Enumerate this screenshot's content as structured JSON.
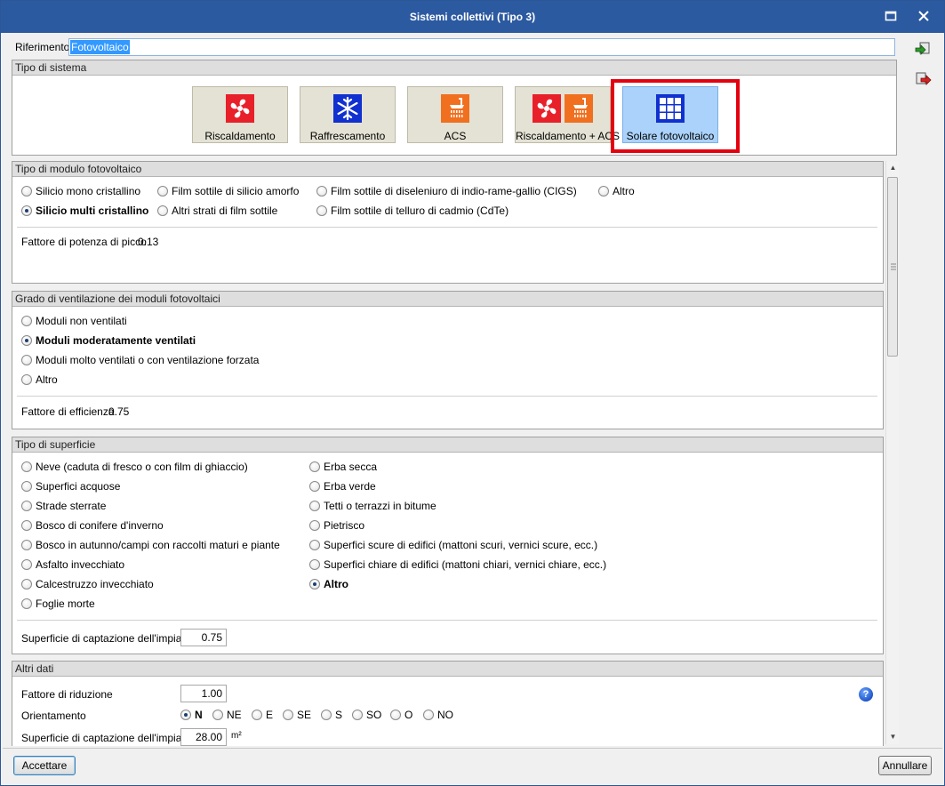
{
  "window": {
    "title": "Sistemi collettivi (Tipo 3)"
  },
  "riferimento": {
    "label": "Riferimento",
    "value": "Fotovoltaico"
  },
  "tipo_sistema": {
    "header": "Tipo di sistema",
    "buttons": [
      {
        "label": "Riscaldamento",
        "icon": "fan-icon"
      },
      {
        "label": "Raffrescamento",
        "icon": "snowflake-icon"
      },
      {
        "label": "ACS",
        "icon": "shower-icon"
      },
      {
        "label": "Riscaldamento + ACS",
        "icon": "fan-shower-icon"
      },
      {
        "label": "Solare fotovoltaico",
        "icon": "solar-panel-icon",
        "selected": true
      }
    ]
  },
  "modulo": {
    "header": "Tipo di modulo fotovoltaico",
    "options": [
      "Silicio mono cristallino",
      "Film sottile di silicio amorfo",
      "Film sottile di diseleniuro di indio-rame-gallio (CIGS)",
      "Altro",
      "Silicio multi cristallino",
      "Altri strati di film sottile",
      "Film sottile di telluro di cadmio (CdTe)"
    ],
    "selected": "Silicio multi cristallino",
    "fattore_label": "Fattore di potenza di picco",
    "fattore_value": "0.13"
  },
  "ventilazione": {
    "header": "Grado di ventilazione dei moduli fotovoltaici",
    "options": [
      "Moduli non ventilati",
      "Moduli moderatamente ventilati",
      "Moduli molto ventilati o con ventilazione forzata",
      "Altro"
    ],
    "selected": "Moduli moderatamente ventilati",
    "fattore_label": "Fattore di efficienza",
    "fattore_value": "0.75"
  },
  "superficie": {
    "header": "Tipo di superficie",
    "options_left": [
      "Neve (caduta di fresco o con film di ghiaccio)",
      "Superfici acquose",
      "Strade sterrate",
      "Bosco di conifere d'inverno",
      "Bosco in autunno/campi con raccolti maturi e piante",
      "Asfalto invecchiato",
      "Calcestruzzo invecchiato",
      "Foglie morte"
    ],
    "options_right": [
      "Erba secca",
      "Erba verde",
      "Tetti o terrazzi in bitume",
      "Pietrisco",
      "Superfici scure di edifici (mattoni scuri, vernici scure, ecc.)",
      "Superfici chiare di edifici (mattoni chiari, vernici chiare, ecc.)",
      "Altro"
    ],
    "selected": "Altro",
    "captazione_label": "Superficie di captazione dell'impianto",
    "captazione_value": "0.75"
  },
  "altri": {
    "header": "Altri dati",
    "riduzione_label": "Fattore di riduzione",
    "riduzione_value": "1.00",
    "orientamento_label": "Orientamento",
    "orientamenti": [
      "N",
      "NE",
      "E",
      "SE",
      "S",
      "SO",
      "O",
      "NO"
    ],
    "orientamento_selected": "N",
    "captazione_label": "Superficie di captazione dell'impianto",
    "captazione_value": "28.00",
    "captazione_unit": "m²"
  },
  "footer": {
    "accept": "Accettare",
    "cancel": "Annullare"
  },
  "colors": {
    "title_bar": "#2c5aa0",
    "accent_red": "#e4000f",
    "selected_button": "#aad2fa",
    "icon_orange": "#f07020",
    "icon_red": "#e8202a",
    "icon_blue": "#1030d0"
  }
}
